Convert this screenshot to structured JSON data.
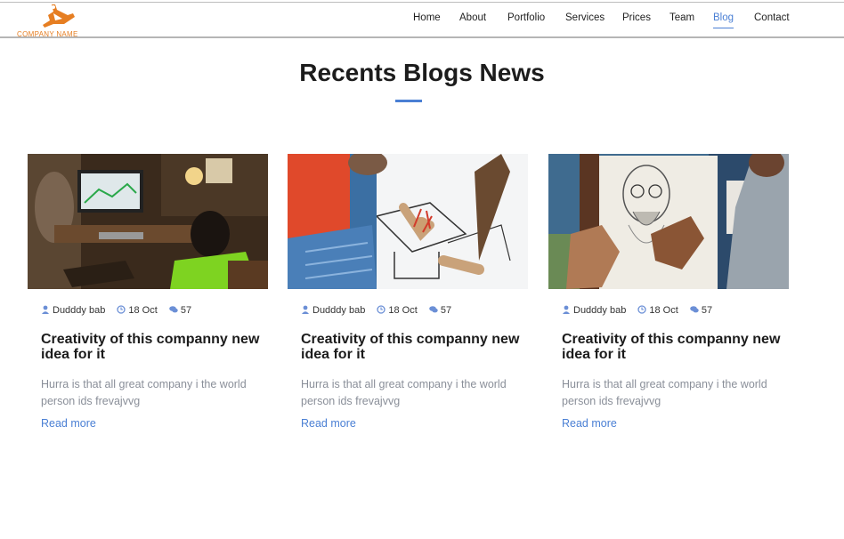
{
  "brand": {
    "name": "COMPANY NAME",
    "accent": "#e67e22"
  },
  "nav": {
    "items": [
      {
        "label": "Home"
      },
      {
        "label": "About"
      },
      {
        "label": "Portfolio"
      },
      {
        "label": "Services"
      },
      {
        "label": "Prices"
      },
      {
        "label": "Team"
      },
      {
        "label": "Blog",
        "active": true
      },
      {
        "label": "Contact"
      }
    ]
  },
  "section": {
    "title": "Recents Blogs News",
    "accent": "#4a7fd4"
  },
  "posts": [
    {
      "author": "Dudddy bab",
      "date": "18 Oct",
      "comments": "57",
      "title": "Creativity of this companny new idea for it",
      "excerpt": "Hurra is that all great company i the world person ids frevajvvg",
      "link": "Read more",
      "image": "person-at-computer-desk"
    },
    {
      "author": "Dudddy bab",
      "date": "18 Oct",
      "comments": "57",
      "title": "Creativity of this companny new idea for it",
      "excerpt": "Hurra is that all great company i the world person ids frevajvvg",
      "link": "Read more",
      "image": "architect-drawing-plans"
    },
    {
      "author": "Dudddy bab",
      "date": "18 Oct",
      "comments": "57",
      "title": "Creativity of this companny new idea for it",
      "excerpt": "Hurra is that all great company i the world person ids frevajvvg",
      "link": "Read more",
      "image": "artist-sketching-portrait"
    }
  ]
}
